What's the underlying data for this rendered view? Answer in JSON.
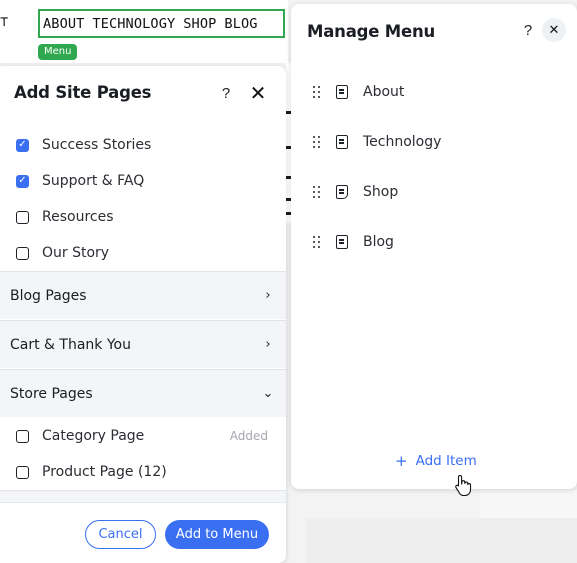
{
  "site_menu_preview": {
    "items": [
      "ABOUT",
      "TECHNOLOGY",
      "SHOP",
      "BLOG"
    ],
    "tag": "Menu"
  },
  "add_site_pages": {
    "title": "Add Site Pages",
    "help": "?",
    "close": "✕",
    "pages": [
      {
        "label": "Success Stories",
        "checked": true
      },
      {
        "label": "Support & FAQ",
        "checked": true
      },
      {
        "label": "Resources",
        "checked": false
      },
      {
        "label": "Our Story",
        "checked": false
      }
    ],
    "sections": [
      {
        "label": "Blog Pages",
        "expanded": false
      },
      {
        "label": "Cart & Thank You",
        "expanded": false
      },
      {
        "label": "Store Pages",
        "expanded": true
      }
    ],
    "store_pages": [
      {
        "label": "Category Page",
        "checked": false,
        "status": "Added"
      },
      {
        "label": "Product Page (12)",
        "checked": false,
        "status": ""
      }
    ],
    "cancel_label": "Cancel",
    "add_label": "Add to Menu"
  },
  "manage_menu": {
    "title": "Manage Menu",
    "help": "?",
    "close": "✕",
    "items": [
      {
        "label": "About",
        "icon": "page-icon"
      },
      {
        "label": "Technology",
        "icon": "page-icon"
      },
      {
        "label": "Shop",
        "icon": "store-page-icon"
      },
      {
        "label": "Blog",
        "icon": "page-icon"
      }
    ],
    "add_item_label": "Add Item"
  },
  "colors": {
    "accent": "#3a6ff2",
    "menu_highlight": "#2fa84f"
  }
}
